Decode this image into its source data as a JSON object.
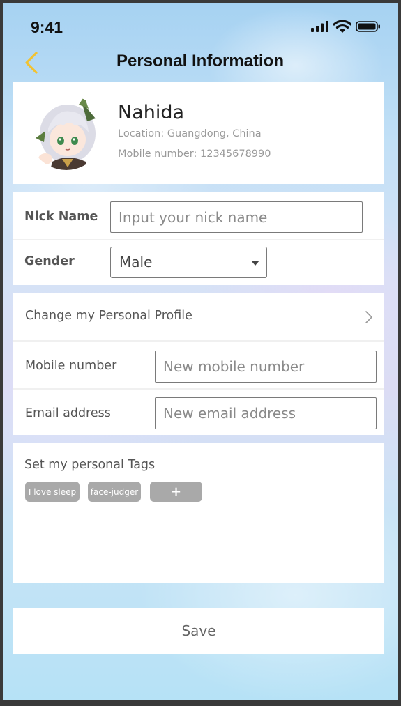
{
  "status_bar": {
    "time": "9:41"
  },
  "nav": {
    "title": "Personal Information",
    "back_icon": "chevron-left-icon",
    "accent_color": "#f2c230"
  },
  "profile": {
    "name": "Nahida",
    "location": "Location: Guangdong, China",
    "mobile": "Mobile number: 12345678990"
  },
  "basic_info": {
    "nickname_label": "Nick Name",
    "nickname_value": "",
    "nickname_placeholder": "Input your nick name",
    "gender_label": "Gender",
    "gender_selected": "Male"
  },
  "contact": {
    "profile_link_label": "Change my Personal Profile",
    "mobile_label": "Mobile number",
    "mobile_value": "",
    "mobile_placeholder": "New mobile number",
    "email_label": "Email address",
    "email_value": "",
    "email_placeholder": "New email address"
  },
  "tags": {
    "title": "Set my personal Tags",
    "items": [
      "I love sleep",
      "face-judger"
    ],
    "add_label": "+",
    "tag_color": "#a9a9a9"
  },
  "actions": {
    "save_label": "Save"
  }
}
